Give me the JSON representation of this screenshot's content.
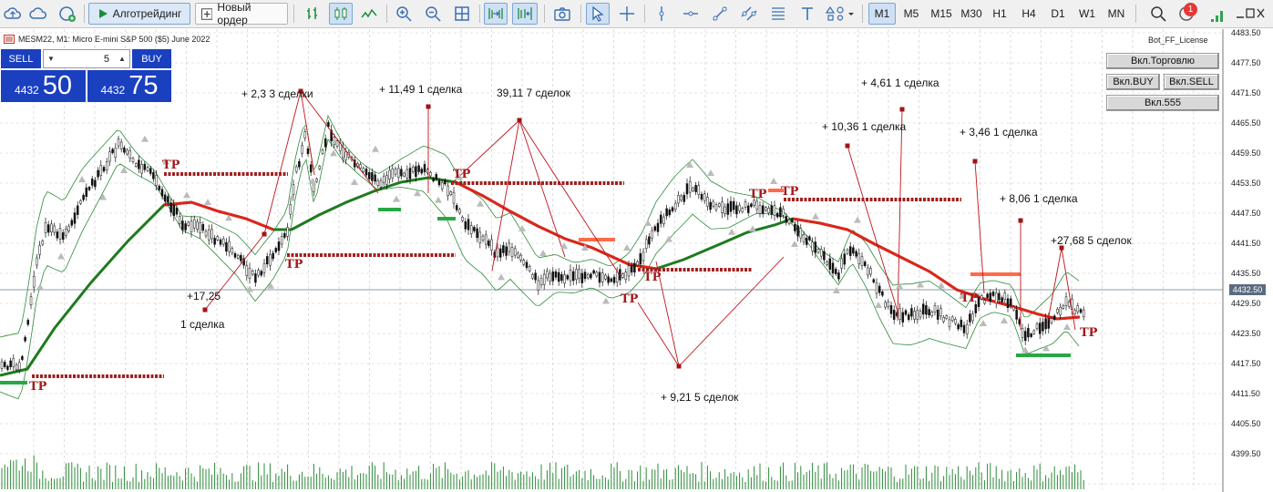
{
  "toolbar": {
    "algo_label": "Алготрейдинг",
    "new_order_label": "Новый ордер",
    "timeframes": [
      "M1",
      "M5",
      "M15",
      "M30",
      "H1",
      "H4",
      "D1",
      "W1",
      "MN"
    ],
    "active_timeframe": "M1",
    "notification_count": "1"
  },
  "chart": {
    "symbol_info": "MESM22, M1:  Micro E-mini S&P 500 ($5) June 2022",
    "license_label": "Bot_FF_License",
    "trade_panel": {
      "sell_label": "SELL",
      "buy_label": "BUY",
      "volume": "5",
      "bid_prefix": "4432",
      "bid_big": "50",
      "ask_prefix": "4432",
      "ask_big": "75"
    },
    "bot_buttons": {
      "trade_on": "Вкл.Торговлю",
      "buy_on": "Вкл.BUY",
      "sell_on": "Вкл.SELL",
      "v555_on": "Вкл.555"
    },
    "annotations": [
      "+ 2,3   3 сделки",
      "+ 11,49  1 сделка",
      "39,11  7 сделок",
      "+ 4,61  1 сделка",
      "+ 10,36  1 сделка",
      "+ 3,46   1 сделка",
      "+ 8,06   1 сделка",
      "+27,68  5 сделок",
      "+17,25",
      "1 сделка",
      "+ 9,21  5 сделок"
    ],
    "tp_label": "TP",
    "price_axis": [
      "4483.50",
      "4477.50",
      "4471.50",
      "4465.50",
      "4459.50",
      "4453.50",
      "4447.50",
      "4441.50",
      "4435.50",
      "4429.50",
      "4423.50",
      "4417.50",
      "4411.50",
      "4405.50",
      "4399.50"
    ],
    "current_price": "4432.50"
  }
}
